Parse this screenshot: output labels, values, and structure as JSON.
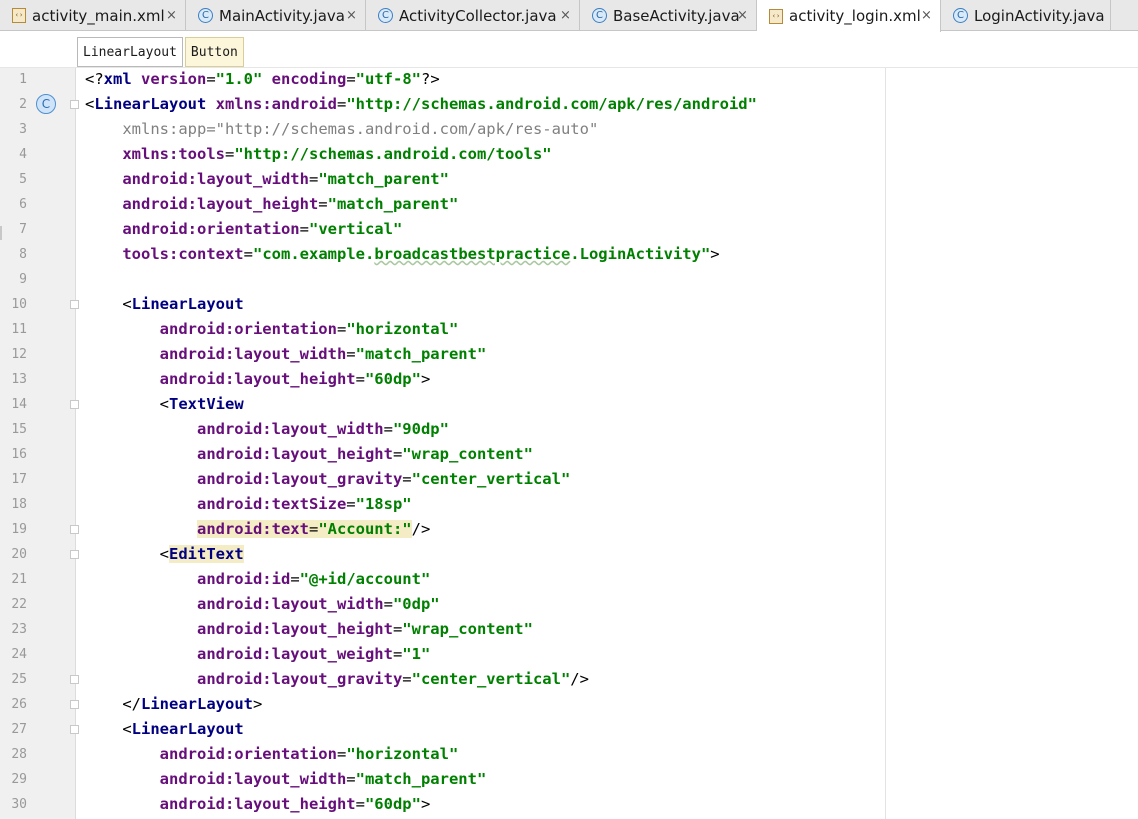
{
  "tabs": [
    {
      "label": "activity_main.xml",
      "icon": "xml-file-icon",
      "active": false
    },
    {
      "label": "MainActivity.java",
      "icon": "class-icon",
      "active": false
    },
    {
      "label": "ActivityCollector.java",
      "icon": "class-icon",
      "active": false
    },
    {
      "label": "BaseActivity.java",
      "icon": "class-icon",
      "active": false
    },
    {
      "label": "activity_login.xml",
      "icon": "xml-file-icon",
      "active": true
    },
    {
      "label": "LoginActivity.java",
      "icon": "class-icon",
      "active": false
    }
  ],
  "tab_close_glyph": "×",
  "breadcrumb": [
    "LinearLayout",
    "Button"
  ],
  "gutter_class_glyph": "C",
  "lines": [
    {
      "n": "1",
      "segs": [
        {
          "t": "<?",
          "c": "br"
        },
        {
          "t": "xml ",
          "c": "tg"
        },
        {
          "t": "version",
          "c": "an"
        },
        {
          "t": "=",
          "c": "br"
        },
        {
          "t": "\"1.0\" ",
          "c": "v"
        },
        {
          "t": "encoding",
          "c": "an"
        },
        {
          "t": "=",
          "c": "br"
        },
        {
          "t": "\"utf-8\"",
          "c": "v"
        },
        {
          "t": "?>",
          "c": "br"
        }
      ]
    },
    {
      "n": "2",
      "segs": [
        {
          "t": "<",
          "c": "br"
        },
        {
          "t": "LinearLayout ",
          "c": "tg"
        },
        {
          "t": "xmlns:android",
          "c": "an"
        },
        {
          "t": "=",
          "c": "br"
        },
        {
          "t": "\"http://schemas.android.com/apk/res/android\"",
          "c": "v"
        }
      ]
    },
    {
      "n": "3",
      "segs": [
        {
          "t": "    ",
          "c": "br"
        },
        {
          "t": "xmlns:app",
          "c": "an-gray"
        },
        {
          "t": "=",
          "c": "v-gray"
        },
        {
          "t": "\"http://schemas.android.com/apk/res-auto\"",
          "c": "v-gray"
        }
      ]
    },
    {
      "n": "4",
      "segs": [
        {
          "t": "    ",
          "c": "br"
        },
        {
          "t": "xmlns:tools",
          "c": "an"
        },
        {
          "t": "=",
          "c": "br"
        },
        {
          "t": "\"http://schemas.android.com/tools\"",
          "c": "v"
        }
      ]
    },
    {
      "n": "5",
      "segs": [
        {
          "t": "    ",
          "c": "br"
        },
        {
          "t": "android:layout_width",
          "c": "an"
        },
        {
          "t": "=",
          "c": "br"
        },
        {
          "t": "\"match_parent\"",
          "c": "v"
        }
      ]
    },
    {
      "n": "6",
      "segs": [
        {
          "t": "    ",
          "c": "br"
        },
        {
          "t": "android:layout_height",
          "c": "an"
        },
        {
          "t": "=",
          "c": "br"
        },
        {
          "t": "\"match_parent\"",
          "c": "v"
        }
      ]
    },
    {
      "n": "7",
      "segs": [
        {
          "t": "    ",
          "c": "br"
        },
        {
          "t": "android:orientation",
          "c": "an"
        },
        {
          "t": "=",
          "c": "br"
        },
        {
          "t": "\"vertical\"",
          "c": "v"
        }
      ]
    },
    {
      "n": "8",
      "segs": [
        {
          "t": "    ",
          "c": "br"
        },
        {
          "t": "tools:context",
          "c": "an"
        },
        {
          "t": "=",
          "c": "br"
        },
        {
          "t": "\"com.example.",
          "c": "v"
        },
        {
          "t": "broadcastbestpractice",
          "c": "v wavy"
        },
        {
          "t": ".LoginActivity\"",
          "c": "v"
        },
        {
          "t": ">",
          "c": "br"
        }
      ]
    },
    {
      "n": "9",
      "segs": []
    },
    {
      "n": "10",
      "segs": [
        {
          "t": "    <",
          "c": "br"
        },
        {
          "t": "LinearLayout",
          "c": "tg"
        }
      ]
    },
    {
      "n": "11",
      "segs": [
        {
          "t": "        ",
          "c": "br"
        },
        {
          "t": "android:orientation",
          "c": "an"
        },
        {
          "t": "=",
          "c": "br"
        },
        {
          "t": "\"horizontal\"",
          "c": "v"
        }
      ]
    },
    {
      "n": "12",
      "segs": [
        {
          "t": "        ",
          "c": "br"
        },
        {
          "t": "android:layout_width",
          "c": "an"
        },
        {
          "t": "=",
          "c": "br"
        },
        {
          "t": "\"match_parent\"",
          "c": "v"
        }
      ]
    },
    {
      "n": "13",
      "segs": [
        {
          "t": "        ",
          "c": "br"
        },
        {
          "t": "android:layout_height",
          "c": "an"
        },
        {
          "t": "=",
          "c": "br"
        },
        {
          "t": "\"60dp\"",
          "c": "v"
        },
        {
          "t": ">",
          "c": "br"
        }
      ]
    },
    {
      "n": "14",
      "segs": [
        {
          "t": "        <",
          "c": "br"
        },
        {
          "t": "TextView",
          "c": "tg"
        }
      ]
    },
    {
      "n": "15",
      "segs": [
        {
          "t": "            ",
          "c": "br"
        },
        {
          "t": "android:layout_width",
          "c": "an"
        },
        {
          "t": "=",
          "c": "br"
        },
        {
          "t": "\"90dp\"",
          "c": "v"
        }
      ]
    },
    {
      "n": "16",
      "segs": [
        {
          "t": "            ",
          "c": "br"
        },
        {
          "t": "android:layout_height",
          "c": "an"
        },
        {
          "t": "=",
          "c": "br"
        },
        {
          "t": "\"wrap_content\"",
          "c": "v"
        }
      ]
    },
    {
      "n": "17",
      "segs": [
        {
          "t": "            ",
          "c": "br"
        },
        {
          "t": "android:layout_gravity",
          "c": "an"
        },
        {
          "t": "=",
          "c": "br"
        },
        {
          "t": "\"center_vertical\"",
          "c": "v"
        }
      ]
    },
    {
      "n": "18",
      "segs": [
        {
          "t": "            ",
          "c": "br"
        },
        {
          "t": "android:textSize",
          "c": "an"
        },
        {
          "t": "=",
          "c": "br"
        },
        {
          "t": "\"18sp\"",
          "c": "v"
        }
      ]
    },
    {
      "n": "19",
      "segs": [
        {
          "t": "            ",
          "c": "br"
        },
        {
          "t": "android:text",
          "c": "an hl"
        },
        {
          "t": "=",
          "c": "br hl"
        },
        {
          "t": "\"Account:\"",
          "c": "v hl"
        },
        {
          "t": "/>",
          "c": "br"
        }
      ]
    },
    {
      "n": "20",
      "segs": [
        {
          "t": "        <",
          "c": "br"
        },
        {
          "t": "EditText",
          "c": "tg hl"
        }
      ]
    },
    {
      "n": "21",
      "segs": [
        {
          "t": "            ",
          "c": "br"
        },
        {
          "t": "android:id",
          "c": "an"
        },
        {
          "t": "=",
          "c": "br"
        },
        {
          "t": "\"@+id/account\"",
          "c": "v"
        }
      ]
    },
    {
      "n": "22",
      "segs": [
        {
          "t": "            ",
          "c": "br"
        },
        {
          "t": "android:layout_width",
          "c": "an"
        },
        {
          "t": "=",
          "c": "br"
        },
        {
          "t": "\"0dp\"",
          "c": "v"
        }
      ]
    },
    {
      "n": "23",
      "segs": [
        {
          "t": "            ",
          "c": "br"
        },
        {
          "t": "android:layout_height",
          "c": "an"
        },
        {
          "t": "=",
          "c": "br"
        },
        {
          "t": "\"wrap_content\"",
          "c": "v"
        }
      ]
    },
    {
      "n": "24",
      "segs": [
        {
          "t": "            ",
          "c": "br"
        },
        {
          "t": "android:layout_weight",
          "c": "an"
        },
        {
          "t": "=",
          "c": "br"
        },
        {
          "t": "\"1\"",
          "c": "v"
        }
      ]
    },
    {
      "n": "25",
      "segs": [
        {
          "t": "            ",
          "c": "br"
        },
        {
          "t": "android:layout_gravity",
          "c": "an"
        },
        {
          "t": "=",
          "c": "br"
        },
        {
          "t": "\"center_vertical\"",
          "c": "v"
        },
        {
          "t": "/>",
          "c": "br"
        }
      ]
    },
    {
      "n": "26",
      "segs": [
        {
          "t": "    </",
          "c": "br"
        },
        {
          "t": "LinearLayout",
          "c": "tg"
        },
        {
          "t": ">",
          "c": "br"
        }
      ]
    },
    {
      "n": "27",
      "segs": [
        {
          "t": "    <",
          "c": "br"
        },
        {
          "t": "LinearLayout",
          "c": "tg"
        }
      ]
    },
    {
      "n": "28",
      "segs": [
        {
          "t": "        ",
          "c": "br"
        },
        {
          "t": "android:orientation",
          "c": "an"
        },
        {
          "t": "=",
          "c": "br"
        },
        {
          "t": "\"horizontal\"",
          "c": "v"
        }
      ]
    },
    {
      "n": "29",
      "segs": [
        {
          "t": "        ",
          "c": "br"
        },
        {
          "t": "android:layout_width",
          "c": "an"
        },
        {
          "t": "=",
          "c": "br"
        },
        {
          "t": "\"match_parent\"",
          "c": "v"
        }
      ]
    },
    {
      "n": "30",
      "segs": [
        {
          "t": "        ",
          "c": "br"
        },
        {
          "t": "android:layout_height",
          "c": "an"
        },
        {
          "t": "=",
          "c": "br"
        },
        {
          "t": "\"60dp\"",
          "c": "v"
        },
        {
          "t": ">",
          "c": "br"
        }
      ]
    }
  ]
}
